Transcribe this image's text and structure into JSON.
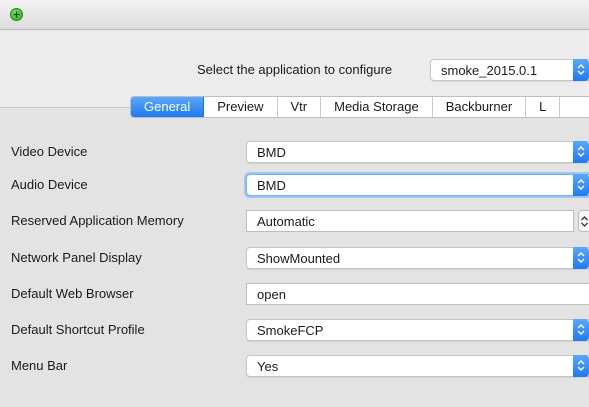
{
  "header": {
    "app_prompt": "Select the application to configure",
    "app_selected": "smoke_2015.0.1"
  },
  "tabs": [
    {
      "label": "General",
      "active": true
    },
    {
      "label": "Preview"
    },
    {
      "label": "Vtr"
    },
    {
      "label": "Media Storage"
    },
    {
      "label": "Backburner"
    },
    {
      "label": "L"
    }
  ],
  "settings": [
    {
      "label": "Video Device",
      "value": "BMD",
      "control": "select"
    },
    {
      "label": "Audio Device",
      "value": "BMD",
      "control": "select"
    },
    {
      "label": "Reserved Application Memory",
      "value": "Automatic",
      "control": "stepper"
    },
    {
      "label": "Network Panel Display",
      "value": "ShowMounted",
      "control": "select"
    },
    {
      "label": "Default Web Browser",
      "value": "open",
      "control": "text"
    },
    {
      "label": "Default Shortcut Profile",
      "value": "SmokeFCP",
      "control": "select"
    },
    {
      "label": "Menu Bar",
      "value": "Yes",
      "control": "select"
    }
  ],
  "colors": {
    "accent": "#1f7af0",
    "window_bg": "#ececec"
  }
}
